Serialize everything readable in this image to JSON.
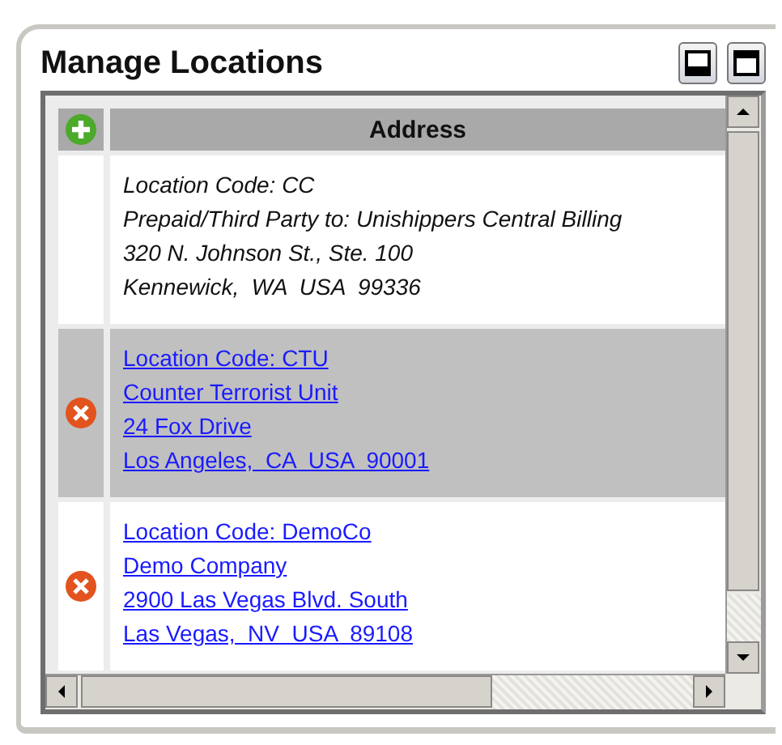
{
  "panel": {
    "title": "Manage Locations"
  },
  "table": {
    "columns": [
      "Address"
    ],
    "rows": [
      {
        "kind": "default",
        "selected": false,
        "lines": [
          "Location Code: CC",
          "Prepaid/Third Party to: Unishippers Central Billing",
          "320 N. Johnson St., Ste. 100",
          "Kennewick,  WA  USA  99336"
        ]
      },
      {
        "kind": "link",
        "selected": true,
        "lines": [
          "Location Code: CTU",
          "Counter Terrorist Unit",
          "24 Fox Drive",
          "Los Angeles,  CA  USA  90001"
        ]
      },
      {
        "kind": "link",
        "selected": false,
        "lines": [
          "Location Code: DemoCo",
          "Demo Company",
          "2900 Las Vegas Blvd. South",
          "Las Vegas,  NV  USA  89108"
        ]
      }
    ]
  }
}
